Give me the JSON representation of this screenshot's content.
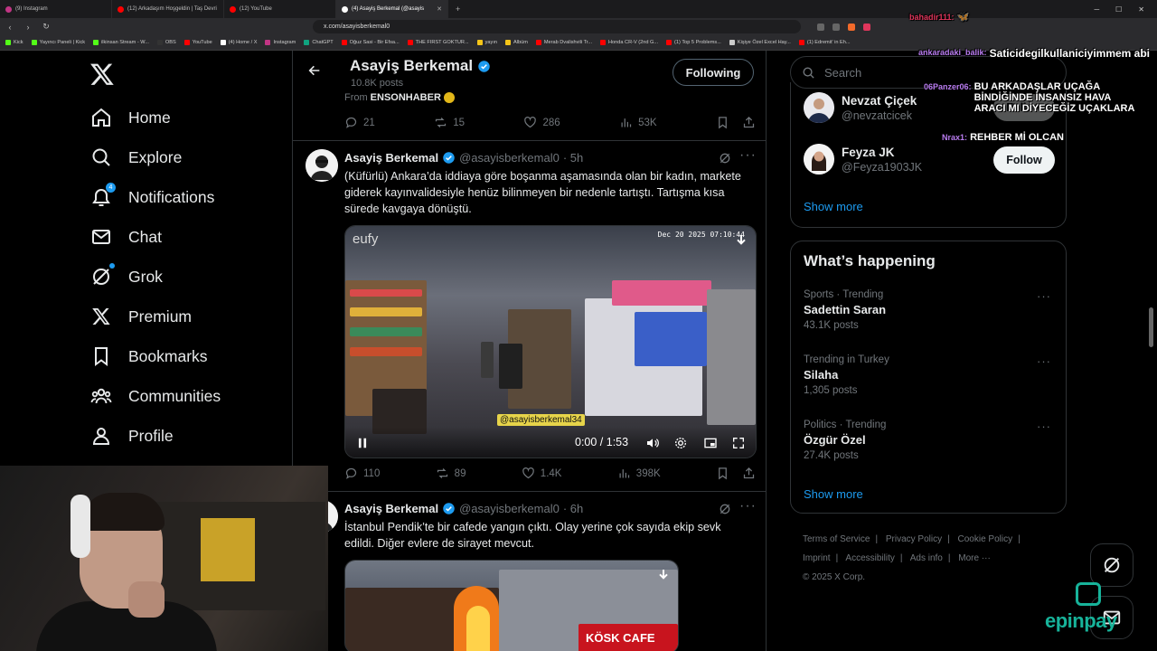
{
  "browser": {
    "tabs": [
      {
        "label": "(9) Instagram",
        "color": "#c13584"
      },
      {
        "label": "(12) Arkadaşım Hoşgeldin | Taş Devri",
        "color": "#ff0000"
      },
      {
        "label": "(12) YouTube",
        "color": "#ff0000"
      },
      {
        "label": "(4) Asayiş Berkemal (@asayis",
        "color": "#ffffff"
      }
    ],
    "url": "x.com/asayisberkemal0",
    "bookmarks": [
      {
        "label": "Kick",
        "color": "#53fc18"
      },
      {
        "label": "Yayıncı Paneli | Kick",
        "color": "#53fc18"
      },
      {
        "label": "ilkinsan Stream - W...",
        "color": "#53fc18"
      },
      {
        "label": "OBS",
        "color": "#333333"
      },
      {
        "label": "YouTube",
        "color": "#ff0000"
      },
      {
        "label": "(4) Home / X",
        "color": "#ffffff"
      },
      {
        "label": "Instagram",
        "color": "#c13584"
      },
      {
        "label": "ChatGPT",
        "color": "#10a37f"
      },
      {
        "label": "Oğuz Sasi - Bir Efsa...",
        "color": "#ff0000"
      },
      {
        "label": "THE FIRST GOKTUR...",
        "color": "#ff0000"
      },
      {
        "label": "yayın",
        "color": "#f5c518"
      },
      {
        "label": "Albüm",
        "color": "#f5c518"
      },
      {
        "label": "Merab Dvalishvili Tr...",
        "color": "#ff0000"
      },
      {
        "label": "Honda CR-V (2nd G...",
        "color": "#ff0000"
      },
      {
        "label": "(1) Top 5 Problems...",
        "color": "#ff0000"
      },
      {
        "label": "Kişiye Özel Excel Hay...",
        "color": "#cccccc"
      },
      {
        "label": "(1) Edremit' in Eh...",
        "color": "#ff0000"
      }
    ]
  },
  "nav": {
    "items": [
      {
        "label": "Home",
        "icon": "home-icon"
      },
      {
        "label": "Explore",
        "icon": "search-icon"
      },
      {
        "label": "Notifications",
        "icon": "bell-icon",
        "badge": "4"
      },
      {
        "label": "Chat",
        "icon": "mail-icon"
      },
      {
        "label": "Grok",
        "icon": "grok-icon"
      },
      {
        "label": "Premium",
        "icon": "x-icon"
      },
      {
        "label": "Bookmarks",
        "icon": "bookmark-icon"
      },
      {
        "label": "Communities",
        "icon": "communities-icon"
      },
      {
        "label": "Profile",
        "icon": "profile-icon"
      }
    ]
  },
  "header": {
    "name": "Asayiş Berkemal",
    "posts": "10.8K posts",
    "follow_label": "Following"
  },
  "prev_tweet": {
    "from_label": "From",
    "from_name": "ENSONHABER",
    "replies": "21",
    "reposts": "15",
    "likes": "286",
    "views": "53K"
  },
  "tweet1": {
    "name": "Asayiş Berkemal",
    "handle": "@asayisberkemal0",
    "time": "· 5h",
    "text": "(Küfürlü) Ankara’da iddiaya göre boşanma aşamasında olan bir kadın, markete giderek kayınvalidesiyle henüz bilinmeyen bir nedenle tartıştı. Tartışma kısa sürede kavgaya dönüştü.",
    "video": {
      "brand": "eufy",
      "timestamp": "Dec 20 2025   07:10:44",
      "watermark": "@asayisberkemal34",
      "timer": "0:00 / 1:53"
    },
    "replies": "110",
    "reposts": "89",
    "likes": "1.4K",
    "views": "398K"
  },
  "tweet2": {
    "name": "Asayiş Berkemal",
    "handle": "@asayisberkemal0",
    "time": "· 6h",
    "text": "İstanbul Pendik’te bir cafede yangın çıktı. Olay yerine çok sayıda ekip sevk edildi. Diğer evlere de sirayet mevcut.",
    "sign": "KÖSK CAFE"
  },
  "right": {
    "search_placeholder": "Search",
    "who_to_follow": [
      {
        "name": "Nevzat Çiçek",
        "handle": "@nevzatcicek",
        "button": "Follow"
      },
      {
        "name": "Feyza JK",
        "handle": "@Feyza1903JK",
        "button": "Follow"
      }
    ],
    "show_more": "Show more",
    "happening_title": "What’s happening",
    "trends": [
      {
        "meta": "Sports · Trending",
        "title": "Sadettin Saran",
        "posts": "43.1K posts"
      },
      {
        "meta": "Trending in Turkey",
        "title": "Silaha",
        "posts": "1,305 posts"
      },
      {
        "meta": "Politics · Trending",
        "title": "Özgür Özel",
        "posts": "27.4K posts"
      }
    ],
    "show_more2": "Show more",
    "footer": [
      "Terms of Service",
      "Privacy Policy",
      "Cookie Policy",
      "Imprint",
      "Accessibility",
      "Ads info",
      "More ···",
      "© 2025 X Corp."
    ]
  },
  "chat_overlay": [
    {
      "user": "bahadir111:",
      "msg": ""
    },
    {
      "user": "ankaradaki_balik:",
      "msg": "Saticidegilkullaniciyimmem abi"
    },
    {
      "user": "06Panzer06:",
      "msg": "BU ARKADAŞLAR UÇAĞA BİNDİĞİNDE İNSANSIZ HAVA ARACI MI DİYECEĞİZ UÇAKLARA"
    },
    {
      "user": "Nrax1:",
      "msg": "REHBER Mİ OLCAN"
    }
  ],
  "brand_overlay": "epinpay",
  "colors": {
    "accent": "#1d9bf0",
    "background": "#000000",
    "border": "#2f3336",
    "muted": "#71767b"
  }
}
